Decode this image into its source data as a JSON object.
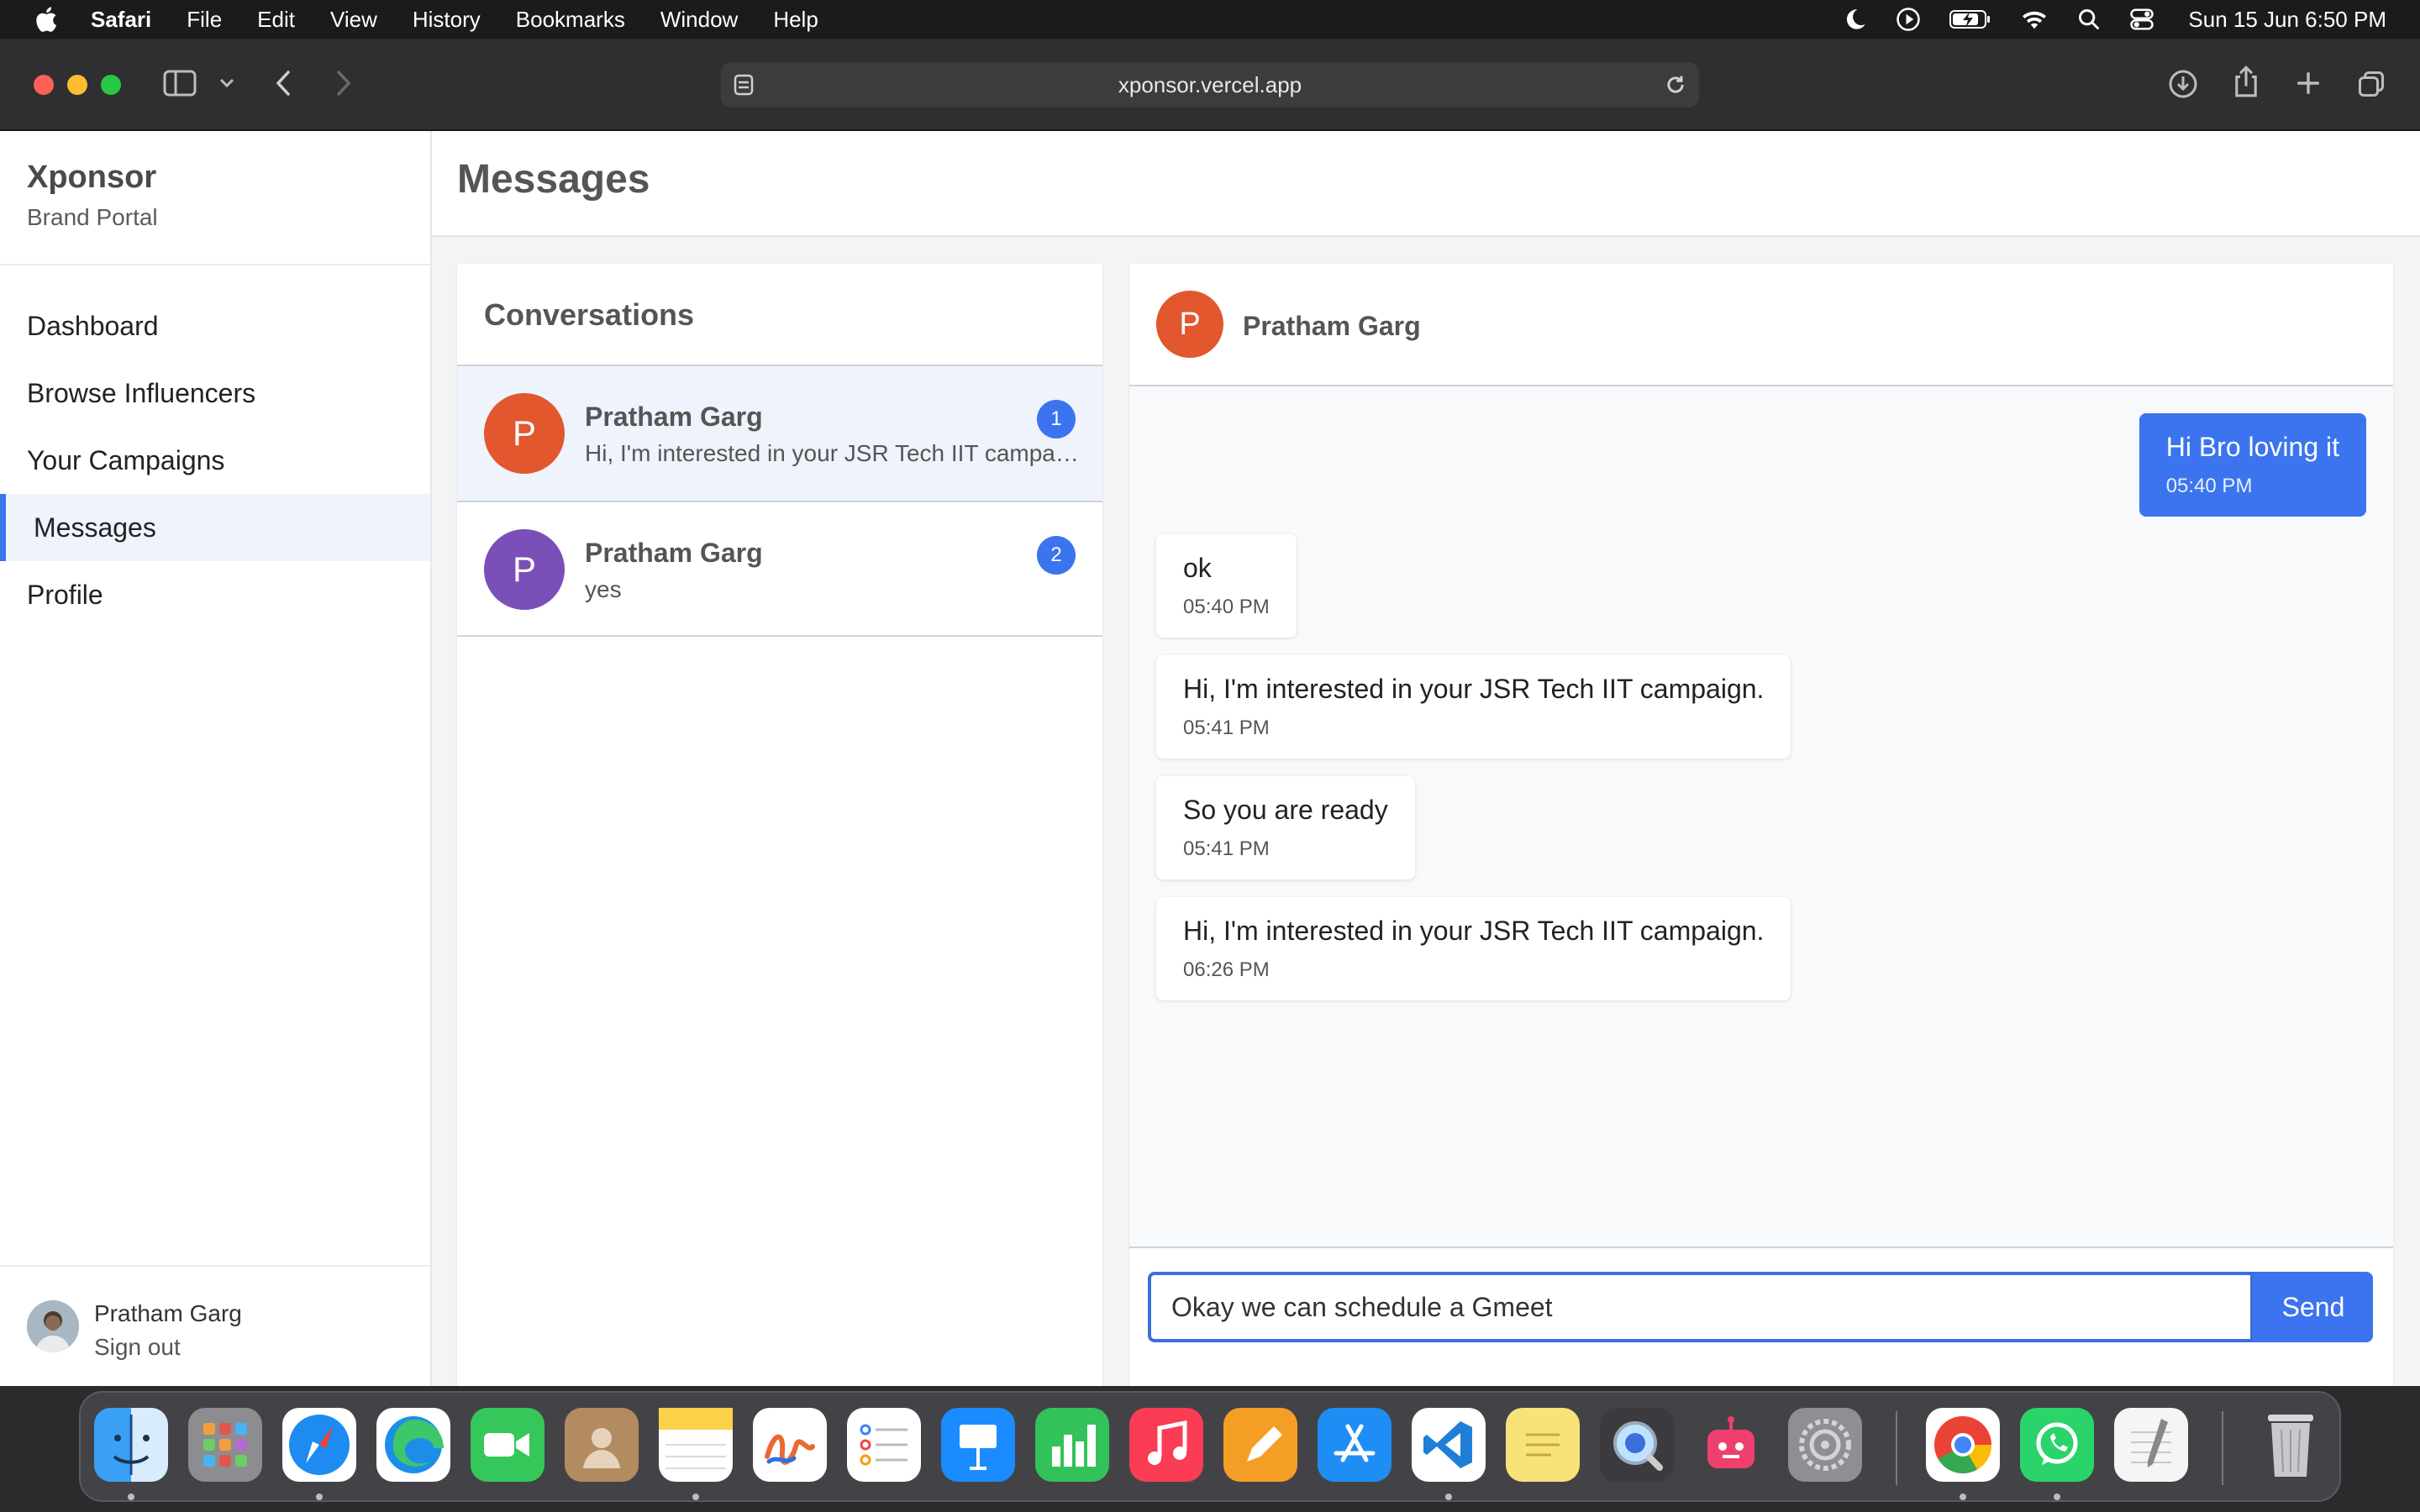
{
  "menubar": {
    "app_name": "Safari",
    "items": [
      "File",
      "Edit",
      "View",
      "History",
      "Bookmarks",
      "Window",
      "Help"
    ],
    "clock": "Sun 15 Jun  6:50 PM",
    "status_icons": [
      "moon-icon",
      "play-circle-icon",
      "battery-icon",
      "wifi-icon",
      "search-icon",
      "control-center-icon"
    ]
  },
  "browser": {
    "url": "xponsor.vercel.app",
    "toolbar_icons": [
      "sidebar-icon",
      "chevron-down-icon",
      "back-icon",
      "forward-icon",
      "download-icon",
      "share-icon",
      "new-tab-icon",
      "tabs-overview-icon"
    ]
  },
  "sidebar": {
    "brand": "Xponsor",
    "subtitle": "Brand Portal",
    "nav": [
      {
        "label": "Dashboard"
      },
      {
        "label": "Browse Influencers"
      },
      {
        "label": "Your Campaigns"
      },
      {
        "label": "Messages",
        "active": true
      },
      {
        "label": "Profile"
      }
    ],
    "user": {
      "name": "Pratham Garg",
      "signout": "Sign out"
    }
  },
  "header": {
    "title": "Messages"
  },
  "conversations": {
    "title": "Conversations",
    "items": [
      {
        "initial": "P",
        "name": "Pratham Garg",
        "preview": "Hi, I'm interested in your JSR Tech IIT campaign.",
        "badge": "1",
        "color": "#e2572e"
      },
      {
        "initial": "P",
        "name": "Pratham Garg",
        "preview": "yes",
        "badge": "2",
        "color": "#7b4fb8"
      }
    ]
  },
  "chat": {
    "contact": {
      "initial": "P",
      "name": "Pratham Garg"
    },
    "messages": [
      {
        "text": "Hi Bro loving it",
        "time": "05:40 PM",
        "direction": "out"
      },
      {
        "text": "ok",
        "time": "05:40 PM",
        "direction": "in"
      },
      {
        "text": "Hi, I'm interested in your JSR Tech IIT campaign.",
        "time": "05:41 PM",
        "direction": "in"
      },
      {
        "text": "So you are ready",
        "time": "05:41 PM",
        "direction": "in"
      },
      {
        "text": "Hi, I'm interested in your JSR Tech IIT campaign.",
        "time": "06:26 PM",
        "direction": "in"
      }
    ],
    "input_value": "Okay we can schedule a Gmeet",
    "send_label": "Send"
  },
  "dock": {
    "apps": [
      "Finder",
      "Launchpad",
      "Safari",
      "Microsoft Edge",
      "FaceTime",
      "Contacts",
      "Notes",
      "Freeform",
      "Reminders",
      "Keynote",
      "Numbers",
      "Music",
      "Pages",
      "App Store",
      "Visual Studio Code",
      "Stickies",
      "QuickTime Player",
      "Bot App",
      "System Settings",
      "Google Chrome",
      "WhatsApp",
      "TextEdit",
      "Trash"
    ]
  },
  "colors": {
    "accent": "#3b74ee",
    "active_nav_bg": "#eef3fc",
    "avatar_orange": "#e2572e",
    "avatar_purple": "#7b4fb8"
  }
}
